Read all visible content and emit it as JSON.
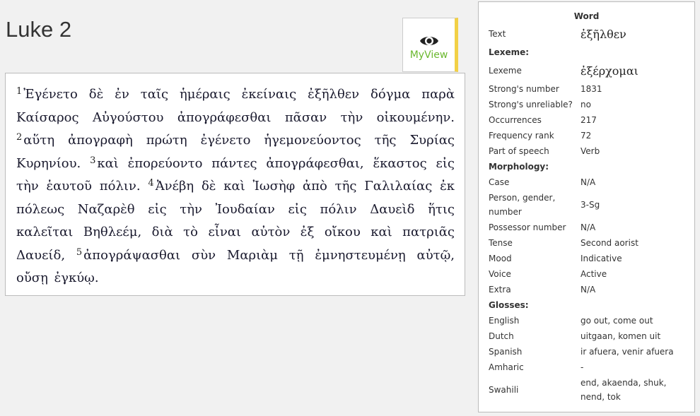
{
  "page": {
    "title": "Luke 2"
  },
  "myview": {
    "label": "MyView",
    "icon": "eye-icon"
  },
  "verses": [
    {
      "num": "1",
      "text": "Ἐγένετο δὲ ἐν ταῖς ἡμέραις ἐκείναις ἐξῆλθεν δόγμα παρὰ Καίσαρος Αὐγούστου ἀπογράφεσθαι πᾶσαν τὴν οἰκουμένην."
    },
    {
      "num": "2",
      "text": "αὕτη ἀπογραφὴ πρώτη ἐγένετο ἡγεμονεύοντος τῆς Συρίας Κυρηνίου."
    },
    {
      "num": "3",
      "text": "καὶ ἐπορεύοντο πάντες ἀπογράφεσθαι, ἕκαστος εἰς τὴν ἑαυτοῦ πόλιν."
    },
    {
      "num": "4",
      "text": "Ἀνέβη δὲ καὶ Ἰωσὴφ ἀπὸ τῆς Γαλιλαίας ἐκ πόλεως Ναζαρὲθ εἰς τὴν Ἰουδαίαν εἰς πόλιν Δαυεὶδ ἥτις καλεῖται Βηθλεέμ, διὰ τὸ εἶναι αὐτὸν ἐξ οἴκου καὶ πατριᾶς Δαυείδ,"
    },
    {
      "num": "5",
      "text": "ἀπογράψασθαι σὺν Μαριὰμ τῇ ἐμνηστευμένῃ αὐτῷ, οὔσῃ ἐγκύῳ."
    }
  ],
  "word_panel": {
    "heading": "Word",
    "text_label": "Text",
    "text_value": "ἐξῆλθεν",
    "lexeme_section": "Lexeme:",
    "lexeme_label": "Lexeme",
    "lexeme_value": "ἐξέρχομαι",
    "strongs_label": "Strong's number",
    "strongs_value": "1831",
    "unreliable_label": "Strong's unreliable?",
    "unreliable_value": "no",
    "occurrences_label": "Occurrences",
    "occurrences_value": "217",
    "freq_label": "Frequency rank",
    "freq_value": "72",
    "pos_label": "Part of speech",
    "pos_value": "Verb",
    "morph_section": "Morphology:",
    "case_label": "Case",
    "case_value": "N/A",
    "pgn_label": "Person, gender, number",
    "pgn_value": "3-Sg",
    "possessor_label": "Possessor number",
    "possessor_value": "N/A",
    "tense_label": "Tense",
    "tense_value": "Second aorist",
    "mood_label": "Mood",
    "mood_value": "Indicative",
    "voice_label": "Voice",
    "voice_value": "Active",
    "extra_label": "Extra",
    "extra_value": "N/A",
    "gloss_section": "Glosses:",
    "english_label": "English",
    "english_value": "go out, come out",
    "dutch_label": "Dutch",
    "dutch_value": "uitgaan, komen uit",
    "spanish_label": "Spanish",
    "spanish_value": "ir afuera, venir afuera",
    "amharic_label": "Amharic",
    "amharic_value": "-",
    "swahili_label": "Swahili",
    "swahili_value": "end, akaenda, shuk, nend, tok"
  }
}
